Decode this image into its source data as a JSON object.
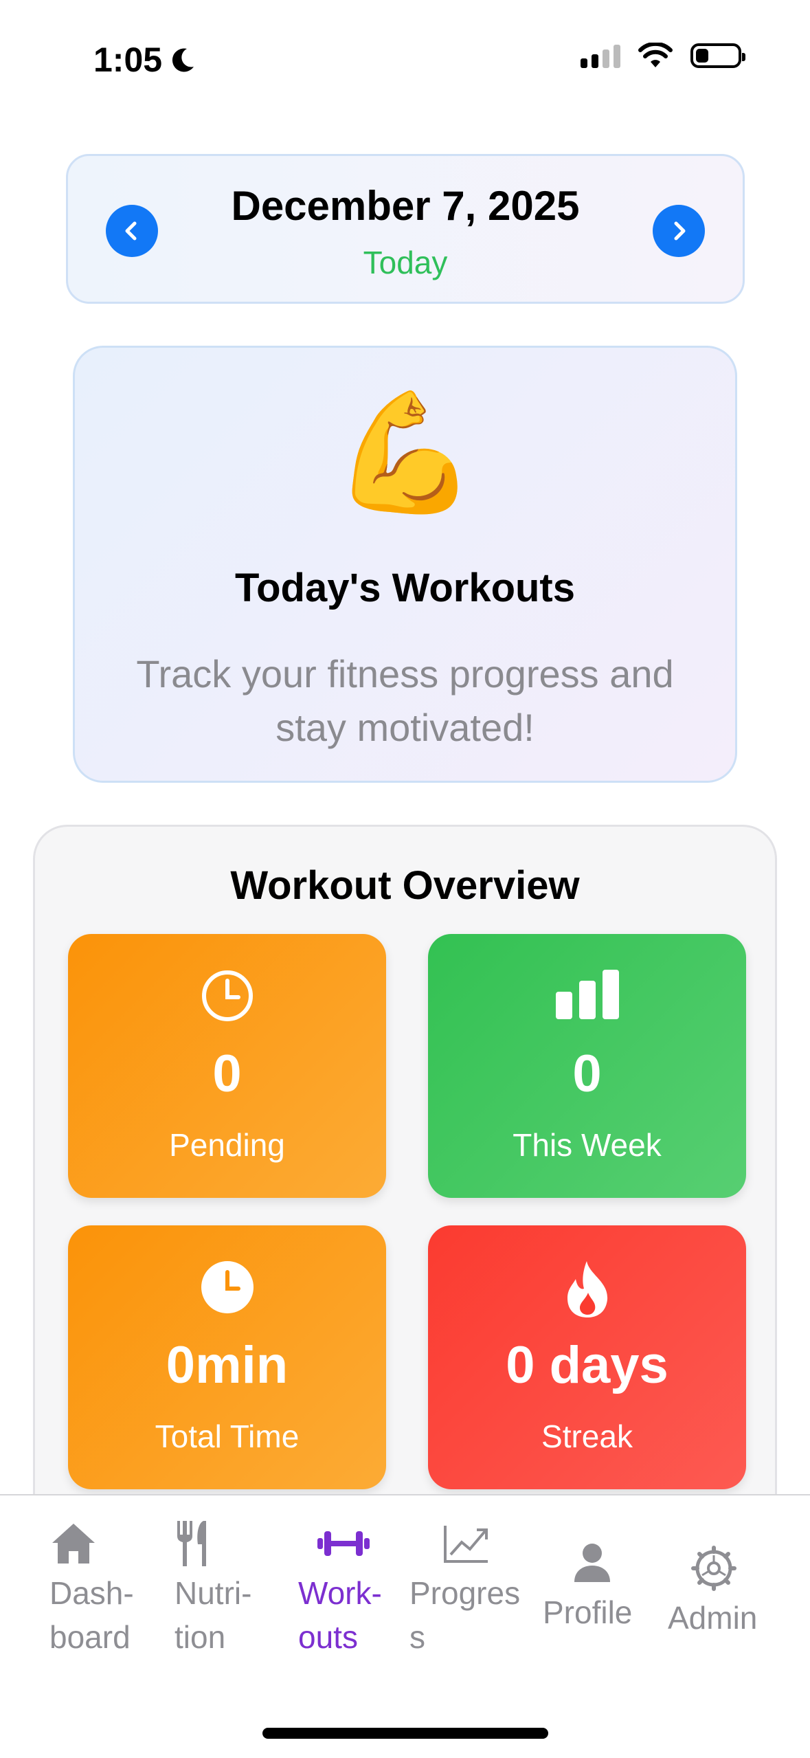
{
  "status_bar": {
    "time": "1:05"
  },
  "date_nav": {
    "date": "December 7, 2025",
    "relative": "Today"
  },
  "hero": {
    "emoji": "💪",
    "title": "Today's Workouts",
    "subtitle": "Track your fitness progress and stay motivated!"
  },
  "overview": {
    "title": "Workout Overview",
    "tiles": [
      {
        "value": "0",
        "label": "Pending",
        "icon": "clock-outline-icon",
        "color": "#fb9309"
      },
      {
        "value": "0",
        "label": "This Week",
        "icon": "bar-chart-icon",
        "color": "#33c152"
      },
      {
        "value": "0min",
        "label": "Total Time",
        "icon": "clock-filled-icon",
        "color": "#fb9309"
      },
      {
        "value": "0 days",
        "label": "Streak",
        "icon": "flame-icon",
        "color": "#fb3b30"
      }
    ]
  },
  "tabs": [
    {
      "label_line1": "Dash-",
      "label_line2": "board",
      "icon": "house-icon"
    },
    {
      "label_line1": "Nutri-",
      "label_line2": "tion",
      "icon": "fork-knife-icon"
    },
    {
      "label_line1": "Work-",
      "label_line2": "outs",
      "icon": "dumbbell-icon",
      "active": true
    },
    {
      "label_line1": "Progres",
      "label_line2": "s",
      "icon": "chart-line-icon"
    },
    {
      "label_line1": "Profile",
      "label_line2": "",
      "icon": "person-icon"
    },
    {
      "label_line1": "Admin",
      "label_line2": "",
      "icon": "gear-icon"
    }
  ],
  "colors": {
    "accent_blue": "#1278f6",
    "today_green": "#2fbf5a",
    "active_tab": "#7c2fd0"
  }
}
